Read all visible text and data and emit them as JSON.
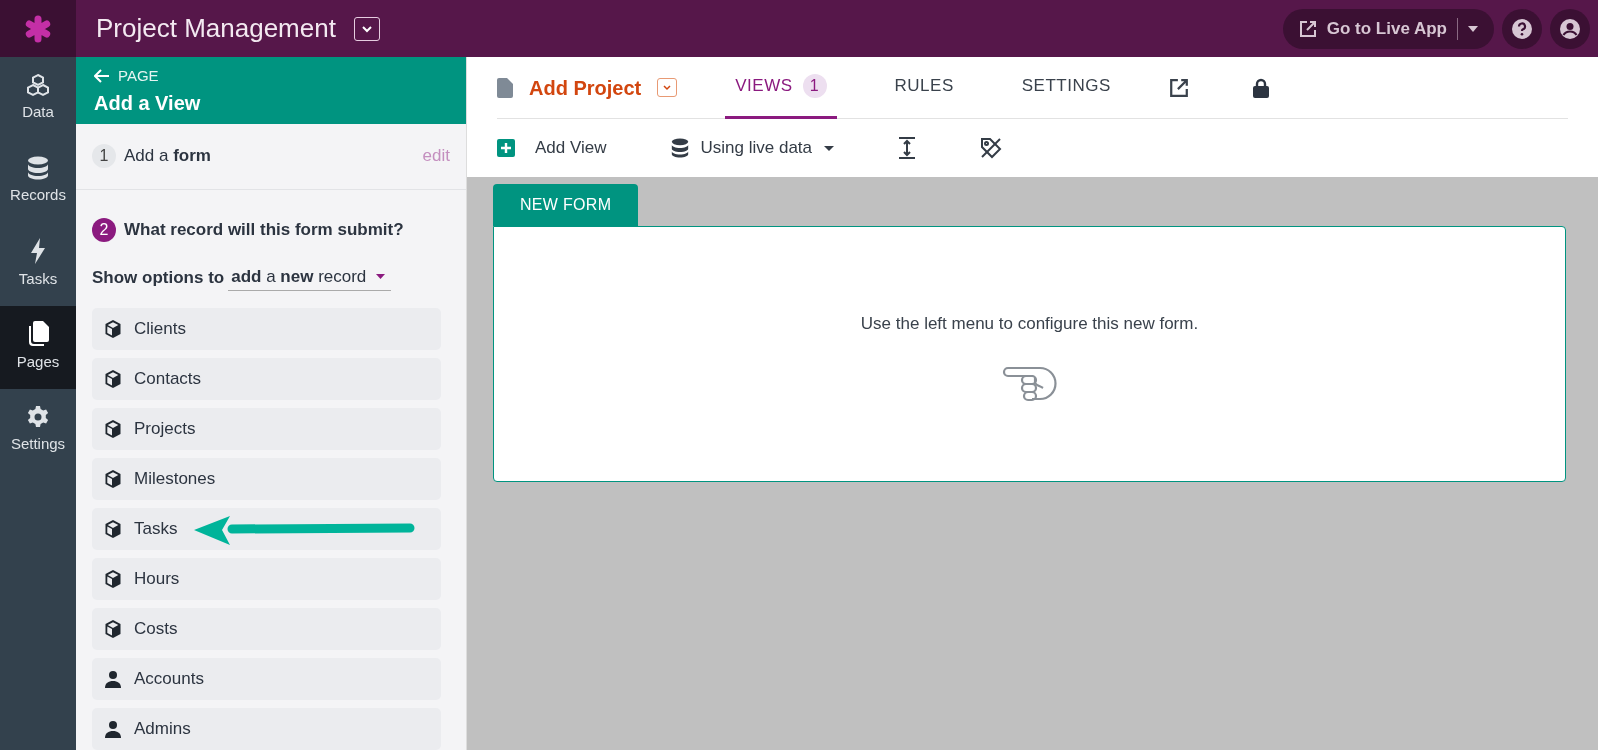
{
  "app": {
    "title": "Project Management"
  },
  "topbar": {
    "live_app": "Go to Live App"
  },
  "nav": [
    {
      "label": "Data",
      "kind": "cubes",
      "selected": false
    },
    {
      "label": "Records",
      "kind": "database",
      "selected": false
    },
    {
      "label": "Tasks",
      "kind": "bolt",
      "selected": false
    },
    {
      "label": "Pages",
      "kind": "pages",
      "selected": true
    },
    {
      "label": "Settings",
      "kind": "gear",
      "selected": false
    }
  ],
  "panel": {
    "back": "PAGE",
    "title": "Add a View",
    "steps": [
      {
        "number": "1",
        "text": "Add a **form**",
        "action": "edit",
        "active": false
      },
      {
        "number": "2",
        "text": "What record will this form submit?",
        "active": true
      }
    ],
    "show_options_label": "Show options to",
    "show_options_value": "**add** a **new** record",
    "records": [
      {
        "label": "Clients",
        "kind": "object"
      },
      {
        "label": "Contacts",
        "kind": "object"
      },
      {
        "label": "Projects",
        "kind": "object"
      },
      {
        "label": "Milestones",
        "kind": "object"
      },
      {
        "label": "Tasks",
        "kind": "object",
        "annotated": true
      },
      {
        "label": "Hours",
        "kind": "object"
      },
      {
        "label": "Costs",
        "kind": "object"
      },
      {
        "label": "Accounts",
        "kind": "user"
      },
      {
        "label": "Admins",
        "kind": "user"
      }
    ]
  },
  "page_header": {
    "title": "Add Project",
    "tabs": [
      {
        "label": "VIEWS",
        "count": "1",
        "selected": true
      },
      {
        "label": "RULES",
        "selected": false
      },
      {
        "label": "SETTINGS",
        "selected": false
      }
    ]
  },
  "toolbar": {
    "add_view": "Add View",
    "data_source": "Using live data"
  },
  "view": {
    "tab": "NEW FORM",
    "message": "Use the left menu to configure this new form."
  }
}
